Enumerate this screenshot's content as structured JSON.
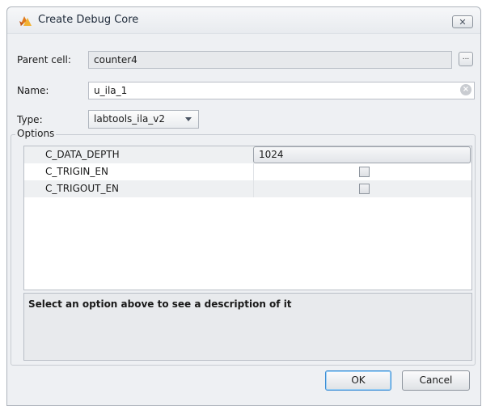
{
  "window": {
    "title": "Create Debug Core",
    "close_symbol": "✕"
  },
  "form": {
    "parent_cell": {
      "label": "Parent cell:",
      "value": "counter4",
      "browse_label": "..."
    },
    "name": {
      "label": "Name:",
      "value": "u_ila_1"
    },
    "type": {
      "label": "Type:",
      "value": "labtools_ila_v2"
    }
  },
  "options": {
    "group_label": "Options",
    "rows": [
      {
        "name": "C_DATA_DEPTH",
        "value": "1024",
        "kind": "dropdown"
      },
      {
        "name": "C_TRIGIN_EN",
        "checked": false,
        "kind": "checkbox"
      },
      {
        "name": "C_TRIGOUT_EN",
        "checked": false,
        "kind": "checkbox"
      }
    ],
    "description": "Select an option above to see a description of it"
  },
  "buttons": {
    "ok": "OK",
    "cancel": "Cancel"
  },
  "colors": {
    "dialog_bg": "#eef0f3",
    "accent_focus": "#3c8fd6",
    "icon_orange": "#e07a1c",
    "icon_yellow": "#f2b233"
  }
}
